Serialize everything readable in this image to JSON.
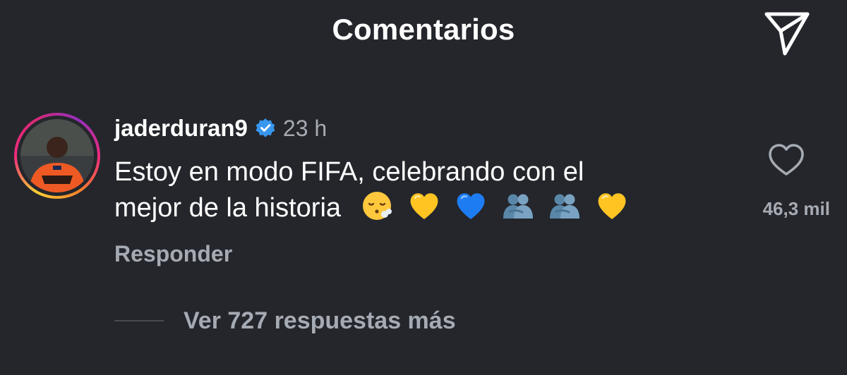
{
  "header": {
    "title": "Comentarios",
    "share_icon": "send-icon"
  },
  "comment": {
    "username": "jaderduran9",
    "verified": true,
    "time": "23 h",
    "text_line1": "Estoy en modo FIFA, celebrando con el",
    "text_line2": "mejor de la historia",
    "emojis": [
      "face-exhaling",
      "yellow-heart",
      "blue-heart",
      "people-hugging",
      "people-hugging",
      "yellow-heart"
    ],
    "reply_label": "Responder",
    "like_count": "46,3 mil"
  },
  "replies": {
    "label": "Ver 727 respuestas más"
  },
  "colors": {
    "background": "#24262c",
    "primary_text": "#ffffff",
    "secondary_text": "#a6aab3",
    "verified_blue": "#3897f0"
  }
}
